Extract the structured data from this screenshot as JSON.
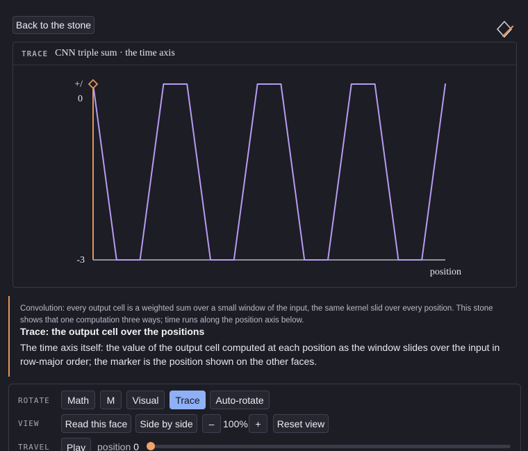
{
  "header": {
    "back_label": "Back to the stone",
    "logo_icon": "diamond-pencil-icon"
  },
  "panel": {
    "tag": "TRACE",
    "title": "CNN triple sum · the time axis"
  },
  "chart_data": {
    "type": "line",
    "series": [
      {
        "points": [
          [
            0,
            0
          ],
          [
            3,
            -3
          ],
          [
            6,
            -3
          ],
          [
            9,
            0
          ],
          [
            12,
            0
          ],
          [
            15,
            -3
          ],
          [
            18,
            -3
          ],
          [
            21,
            0
          ],
          [
            24,
            0
          ],
          [
            27,
            -3
          ],
          [
            30,
            -3
          ],
          [
            33,
            0
          ],
          [
            36,
            0
          ],
          [
            39,
            -3
          ],
          [
            42,
            -3
          ],
          [
            45,
            0
          ]
        ]
      }
    ],
    "xlabel": "position",
    "ylim": [
      -3,
      0
    ],
    "xlim": [
      0,
      45
    ],
    "yticks": [
      "+/",
      "0",
      "-3"
    ],
    "marker_x": 0,
    "line_color": "#b79cf0",
    "axis_color": "#e5965a"
  },
  "description": {
    "intro": "Convolution: every output cell is a weighted sum over a small window of the input, the same kernel slid over every position. This stone shows that one computation three ways; time runs along the position axis below.",
    "heading": "Trace: the output cell over the positions",
    "body": "The time axis itself: the value of the output cell computed at each position as the window slides over the input in row-major order; the marker is the position shown on the other faces."
  },
  "controls": {
    "rotate_label": "ROTATE",
    "view_label": "VIEW",
    "travel_label": "TRAVEL",
    "rotate_buttons": [
      "Math",
      "M",
      "Visual",
      "Trace",
      "Auto-rotate"
    ],
    "active_face": "Trace",
    "read_face": "Read this face",
    "side_by_side": "Side by side",
    "zoom_out": "–",
    "zoom_in": "+",
    "zoom": "100%",
    "reset": "Reset view",
    "play": "Play",
    "position_text": "position",
    "position_value": "0",
    "position_fraction": 0
  }
}
